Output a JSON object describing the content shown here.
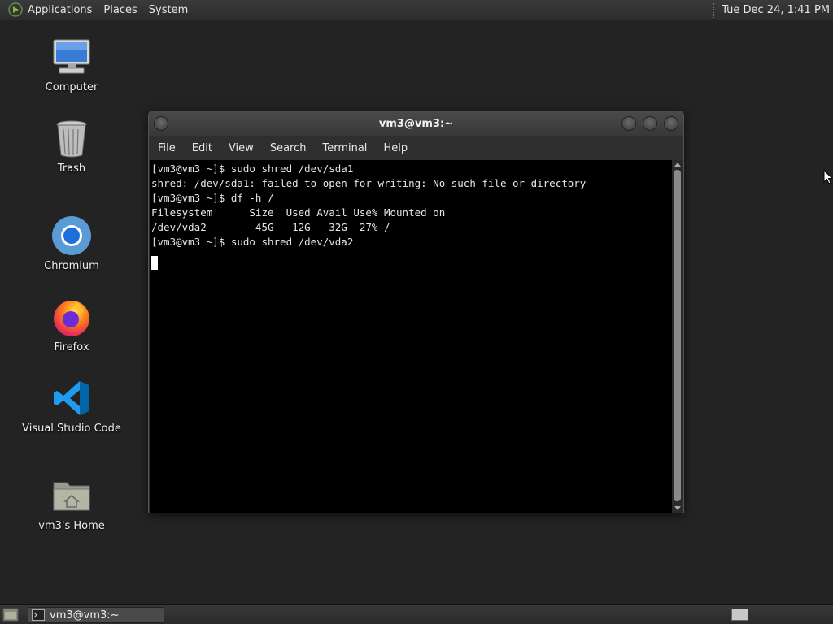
{
  "top_panel": {
    "menus": [
      "Applications",
      "Places",
      "System"
    ],
    "clock": "Tue Dec 24,  1:41 PM"
  },
  "desktop_icons": [
    {
      "label": "Computer",
      "icon": "computer-icon"
    },
    {
      "label": "Trash",
      "icon": "trash-icon"
    },
    {
      "label": "Chromium",
      "icon": "chromium-icon"
    },
    {
      "label": "Firefox",
      "icon": "firefox-icon"
    },
    {
      "label": "Visual Studio Code",
      "icon": "vscode-icon"
    },
    {
      "label": "vm3's Home",
      "icon": "home-folder-icon"
    }
  ],
  "terminal": {
    "title": "vm3@vm3:~",
    "menu": [
      "File",
      "Edit",
      "View",
      "Search",
      "Terminal",
      "Help"
    ],
    "lines": [
      "[vm3@vm3 ~]$ sudo shred /dev/sda1",
      "shred: /dev/sda1: failed to open for writing: No such file or directory",
      "[vm3@vm3 ~]$ df -h /",
      "Filesystem      Size  Used Avail Use% Mounted on",
      "/dev/vda2        45G   12G   32G  27% /",
      "[vm3@vm3 ~]$ sudo shred /dev/vda2"
    ]
  },
  "taskbar": {
    "window_button": "vm3@vm3:~"
  }
}
